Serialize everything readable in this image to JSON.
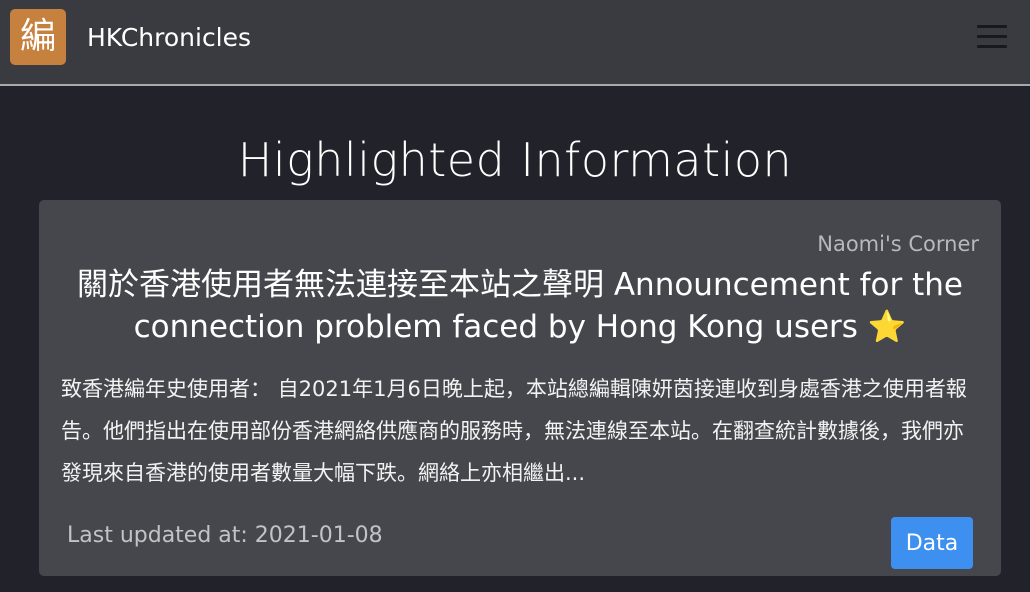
{
  "navbar": {
    "logo_char": "編",
    "brand": "HKChronicles",
    "menu_icon": "hamburger-menu-icon"
  },
  "main": {
    "title": "Highlighted Information"
  },
  "card": {
    "category": "Naomi's Corner",
    "title": "關於香港使用者無法連接至本站之聲明 Announcement for the connection problem faced by Hong Kong users",
    "title_icon": "⭐",
    "body": "致香港編年史使用者： 自2021年1月6日晚上起，本站總編輯陳妍茵接連收到身處香港之使用者報告。他們指出在使用部份香港網絡供應商的服務時，無法連線至本站。在翻查統計數據後，我們亦發現來自香港的使用者數量大幅下跌。網絡上亦相繼出...",
    "updated": "Last updated at: 2021-01-08",
    "button_label": "Data"
  },
  "colors": {
    "background": "#22232a",
    "navbar": "#3a3b41",
    "card": "#46474d",
    "logo": "#c6813f",
    "button": "#3d8ff0",
    "star": "#f3c232"
  }
}
